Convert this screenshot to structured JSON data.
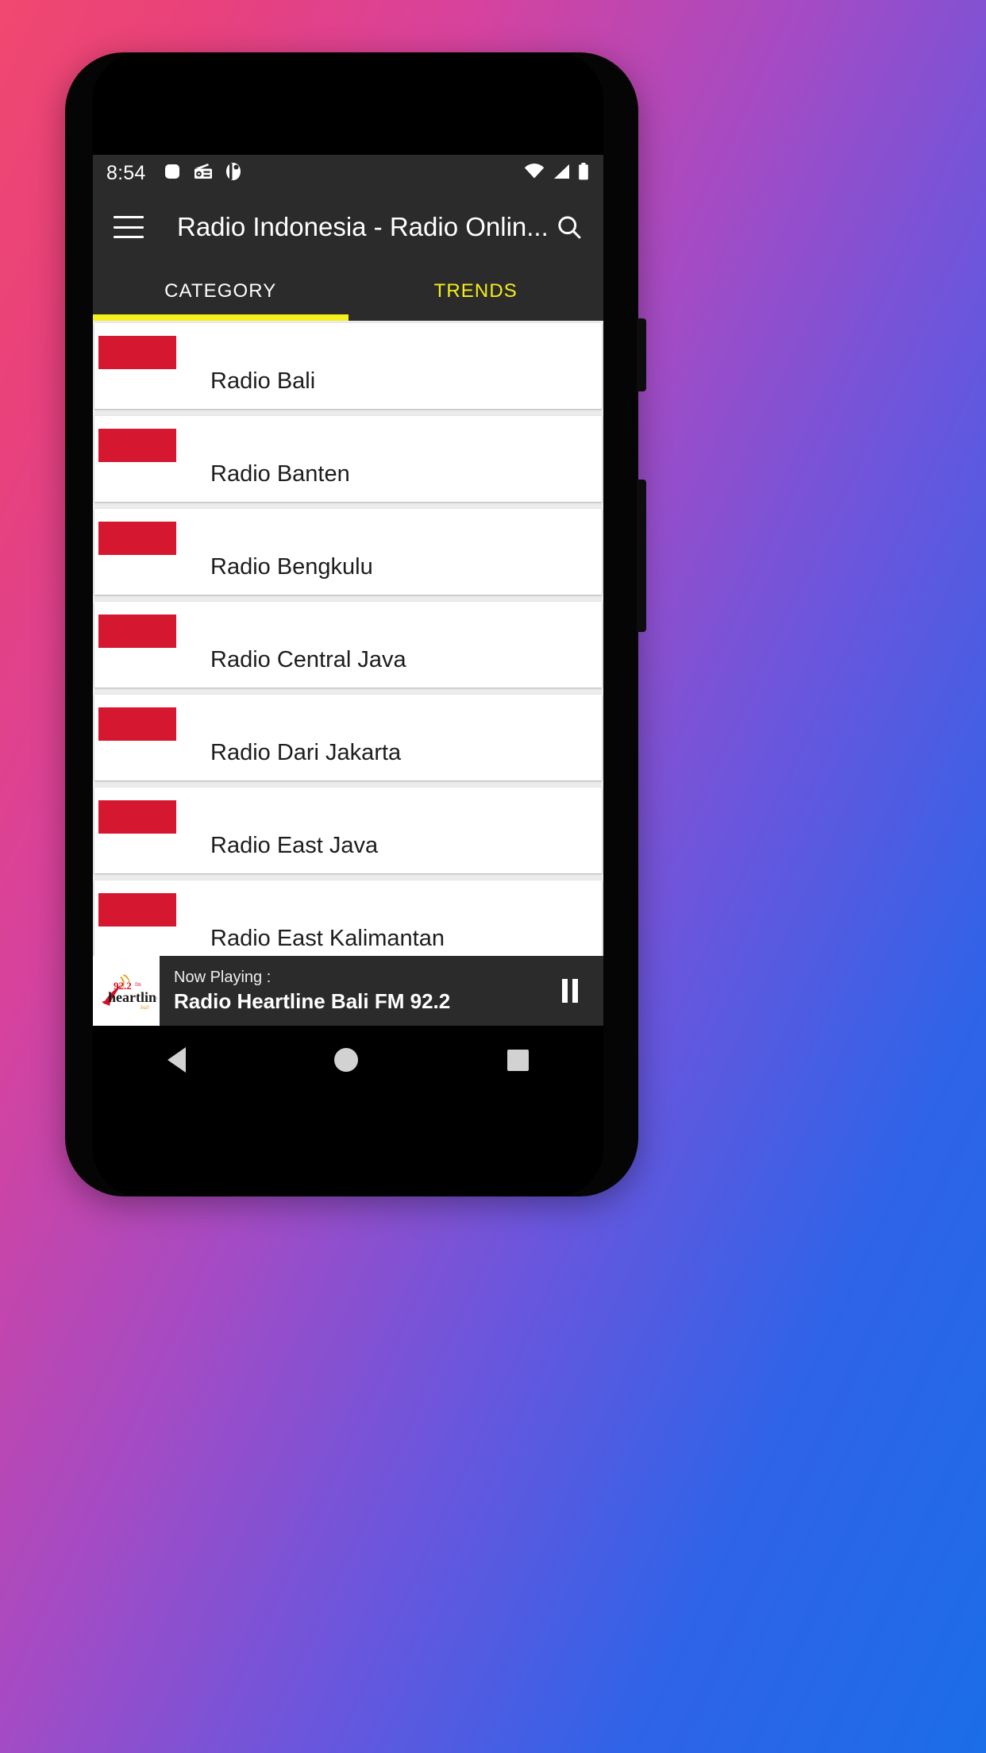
{
  "status_bar": {
    "time": "8:54",
    "notification_icons": [
      "app-square-icon",
      "radio-icon",
      "media-icon"
    ],
    "right_icons": [
      "wifi-icon",
      "signal-icon",
      "battery-icon"
    ]
  },
  "toolbar": {
    "menu_icon": "hamburger-menu-icon",
    "title": "Radio Indonesia - Radio Onlin...",
    "search_icon": "search-icon"
  },
  "tabs": {
    "items": [
      {
        "label": "CATEGORY",
        "active": true
      },
      {
        "label": "TRENDS",
        "active": false
      }
    ],
    "indicator_color": "#f7ef1b",
    "active_text_color": "#ffffff",
    "inactive_text_color": "#f6ee1a"
  },
  "list": {
    "flag_color": "#d51730",
    "items": [
      {
        "label": "Radio Bali"
      },
      {
        "label": "Radio Banten"
      },
      {
        "label": "Radio Bengkulu"
      },
      {
        "label": "Radio Central Java"
      },
      {
        "label": "Radio Dari Jakarta"
      },
      {
        "label": "Radio East Java"
      },
      {
        "label": "Radio East Kalimantan"
      }
    ]
  },
  "now_playing": {
    "label": "Now Playing :",
    "title": "Radio Heartline Bali FM 92.2",
    "logo": {
      "frequency": "92.2",
      "fm_suffix": "fm",
      "name": "heartline",
      "sub": "bali"
    },
    "button_icon": "pause-icon"
  },
  "navigation_bar": {
    "back_icon": "back-triangle-icon",
    "home_icon": "home-circle-icon",
    "recents_icon": "recents-square-icon"
  }
}
